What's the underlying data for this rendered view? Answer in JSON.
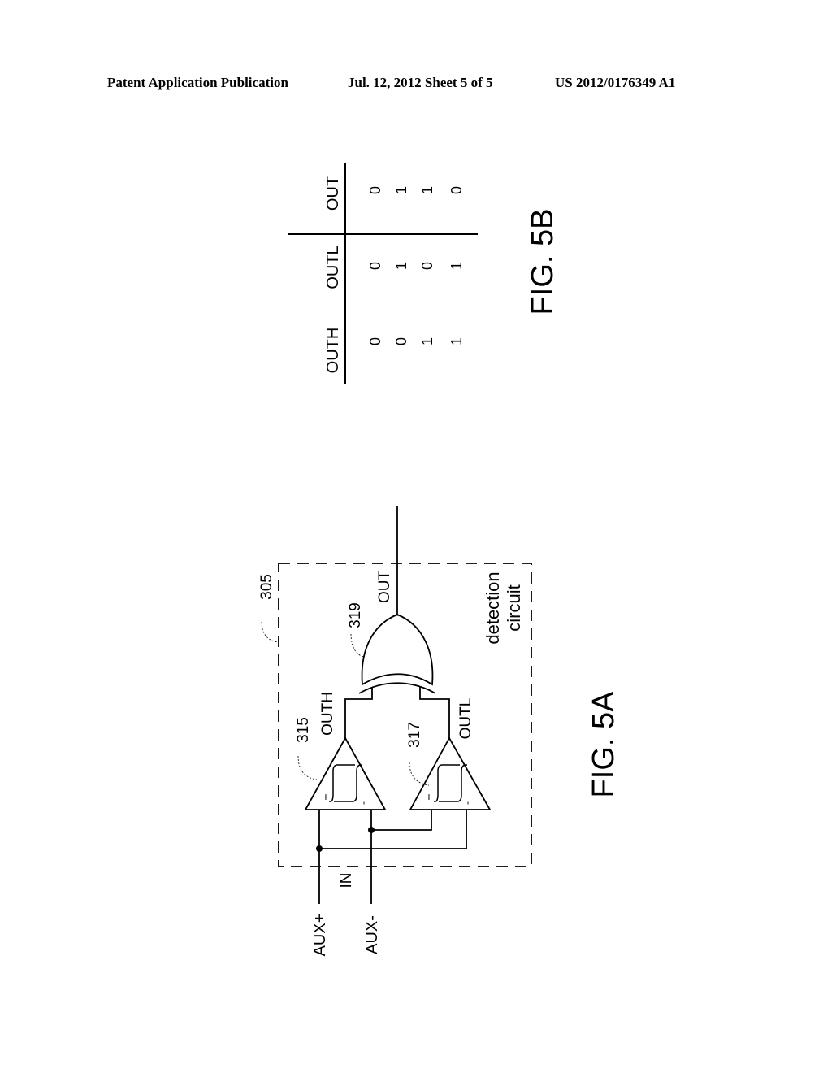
{
  "header": {
    "publication_type": "Patent Application Publication",
    "date_sheet": "Jul. 12, 2012   Sheet 5 of 5",
    "patent_number": "US 2012/0176349 A1"
  },
  "fig5b": {
    "caption": "FIG. 5B",
    "columns": [
      "OUTH",
      "OUTL",
      "OUT"
    ],
    "rows": [
      [
        "0",
        "0",
        "0"
      ],
      [
        "0",
        "1",
        "1"
      ],
      [
        "1",
        "0",
        "1"
      ],
      [
        "1",
        "1",
        "0"
      ]
    ]
  },
  "fig5a": {
    "caption": "FIG. 5A",
    "block_ref": "305",
    "block_label_line1": "detection",
    "block_label_line2": "circuit",
    "comparator_high_ref": "315",
    "comparator_low_ref": "317",
    "xor_ref": "319",
    "signal_outh": "OUTH",
    "signal_outl": "OUTL",
    "signal_out": "OUT",
    "input_label": "IN",
    "input_pos": "AUX+",
    "input_neg": "AUX-",
    "plus_sign": "+",
    "minus_sign": "-"
  }
}
